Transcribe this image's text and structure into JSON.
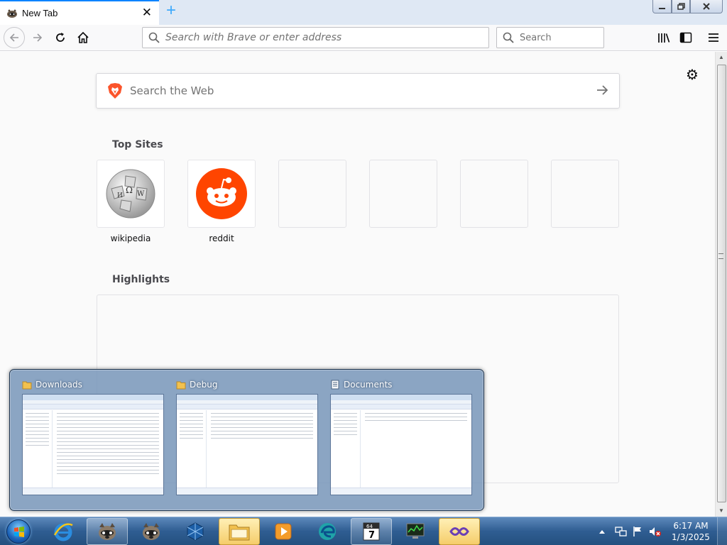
{
  "tab": {
    "title": "New Tab",
    "close": "✕",
    "new_tab": "+"
  },
  "window_controls": {
    "minimize": "minimize",
    "maximize": "restore",
    "close": "close"
  },
  "navbar": {
    "url_placeholder": "Search with Brave or enter address",
    "search_placeholder": "Search"
  },
  "newtab": {
    "websearch_placeholder": "Search the Web",
    "top_sites_title": "Top Sites",
    "top_sites": [
      {
        "label": "wikipedia",
        "icon": "wikipedia-logo"
      },
      {
        "label": "reddit",
        "icon": "reddit-logo"
      },
      {
        "label": "",
        "icon": ""
      },
      {
        "label": "",
        "icon": ""
      },
      {
        "label": "",
        "icon": ""
      },
      {
        "label": "",
        "icon": ""
      }
    ],
    "highlights_title": "Highlights"
  },
  "peek": {
    "windows": [
      {
        "title": "Downloads",
        "icon": "folder-icon"
      },
      {
        "title": "Debug",
        "icon": "folder-icon"
      },
      {
        "title": "Documents",
        "icon": "document-icon"
      }
    ]
  },
  "taskbar": {
    "buttons": [
      "internet-explorer",
      "brave-browser",
      "brave-browser-2",
      "virtualbox",
      "windows-explorer",
      "media-player",
      "edge",
      "7zip",
      "task-manager",
      "visual-studio"
    ],
    "clock_time": "6:17 AM",
    "clock_date": "1/3/2025"
  },
  "colors": {
    "brave_orange": "#fb542b",
    "reddit_orange": "#ff4500",
    "accent_blue": "#0a84ff"
  }
}
